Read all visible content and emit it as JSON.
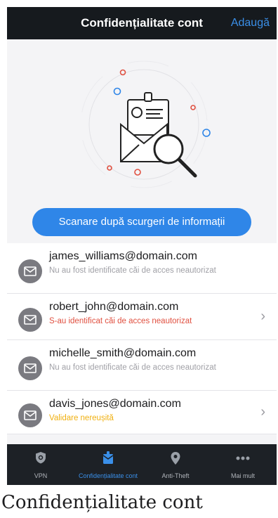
{
  "header": {
    "title": "Confidențialitate cont",
    "add_label": "Adaugă"
  },
  "hero": {
    "scan_button": "Scanare după scurgeri de informații"
  },
  "accounts": [
    {
      "email": "james_williams@domain.com",
      "status": "Nu au fost identificate căi de acces neautorizat",
      "status_type": "ok",
      "has_chevron": false
    },
    {
      "email": "robert_john@domain.com",
      "status": "S-au identificat căi de acces neautorizat",
      "status_type": "bad",
      "has_chevron": true
    },
    {
      "email": "michelle_smith@domain.com",
      "status": "Nu au fost identificate căi de acces neautorizat",
      "status_type": "ok",
      "has_chevron": false
    },
    {
      "email": "davis_jones@domain.com",
      "status": "Validare nereușită",
      "status_type": "warn",
      "has_chevron": true
    }
  ],
  "tabs": [
    {
      "label": "VPN",
      "icon": "shield-icon",
      "active": false
    },
    {
      "label": "Confidențialitate cont",
      "icon": "account-privacy-icon",
      "active": true
    },
    {
      "label": "Anti-Theft",
      "icon": "location-pin-icon",
      "active": false
    },
    {
      "label": "Mai mult",
      "icon": "more-dots-icon",
      "active": false
    }
  ],
  "chevron_glyph": "›",
  "caption": "Confidențialitate cont",
  "colors": {
    "accent": "#2f86e8",
    "danger": "#e05040",
    "warning": "#f0b010",
    "header_bg": "#161a1e"
  }
}
